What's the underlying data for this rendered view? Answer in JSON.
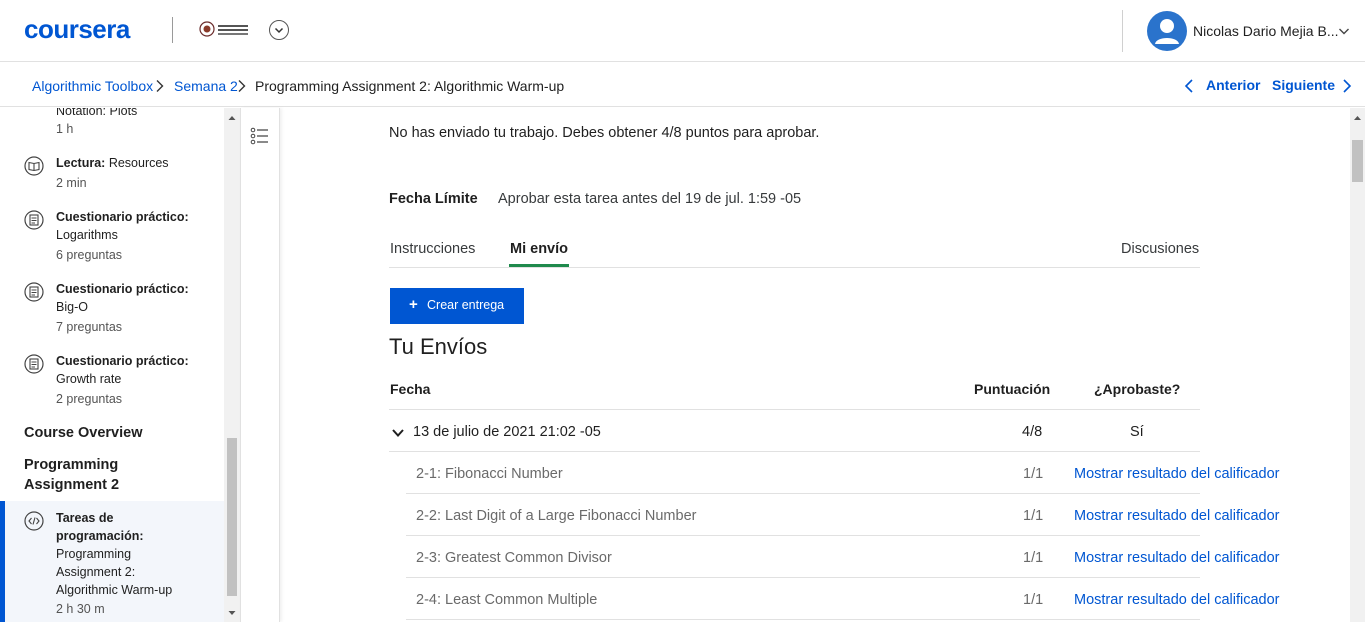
{
  "header": {
    "logo": "coursera",
    "partner_logo_text": "UNIVERSIDAD NACIONAL DE COLOMBIA",
    "user_name": "Nicolas Dario Mejia B...",
    "colors": {
      "brand": "#0056d2",
      "avatar": "#2a73cc"
    }
  },
  "breadcrumb": {
    "items": [
      "Algorithmic Toolbox",
      "Semana 2",
      "Programming Assignment 2: Algorithmic Warm-up"
    ],
    "prev_label": "Anterior",
    "next_label": "Siguiente"
  },
  "sidebar": {
    "top_partial": {
      "title": "Notation: Plots",
      "meta": "1 h"
    },
    "items": [
      {
        "type": "Lectura:",
        "name": "Resources",
        "meta": "2 min",
        "icon": "book-icon"
      },
      {
        "type": "Cuestionario práctico:",
        "name": "Logarithms",
        "meta": "6 preguntas",
        "icon": "quiz-icon"
      },
      {
        "type": "Cuestionario práctico:",
        "name": "Big-O",
        "meta": "7 preguntas",
        "icon": "quiz-icon"
      },
      {
        "type": "Cuestionario práctico:",
        "name": "Growth rate",
        "meta": "2 preguntas",
        "icon": "quiz-icon"
      }
    ],
    "section_overview": "Course Overview",
    "section_assignment_line1": "Programming",
    "section_assignment_line2": "Assignment 2",
    "active_item": {
      "type_line1": "Tareas de",
      "type_line2": "programación:",
      "name_line1": "Programming",
      "name_line2": "Assignment 2:",
      "name_line3": "Algorithmic Warm-up",
      "meta": "2 h 30 m",
      "icon": "code-icon"
    }
  },
  "main": {
    "notice": "No has enviado tu trabajo. Debes obtener 4/8 puntos para aprobar.",
    "deadline_label": "Fecha Límite",
    "deadline_value": "Aprobar esta tarea antes del 19 de jul. 1:59 -05",
    "tabs": {
      "instructions": "Instrucciones",
      "my_submission": "Mi envío",
      "discussions": "Discusiones"
    },
    "create_button": "Crear entrega",
    "submissions_title": "Tu Envíos",
    "table_headers": {
      "date": "Fecha",
      "score": "Puntuación",
      "passed": "¿Aprobaste?"
    },
    "submission": {
      "date": "13 de julio de 2021 21:02 -05",
      "score": "4/8",
      "passed": "Sí"
    },
    "parts": [
      {
        "name": "2-1: Fibonacci Number",
        "score": "1/1",
        "link": "Mostrar resultado del calificador"
      },
      {
        "name": "2-2: Last Digit of a Large Fibonacci Number",
        "score": "1/1",
        "link": "Mostrar resultado del calificador"
      },
      {
        "name": "2-3: Greatest Common Divisor",
        "score": "1/1",
        "link": "Mostrar resultado del calificador"
      },
      {
        "name": "2-4: Least Common Multiple",
        "score": "1/1",
        "link": "Mostrar resultado del calificador"
      }
    ]
  }
}
